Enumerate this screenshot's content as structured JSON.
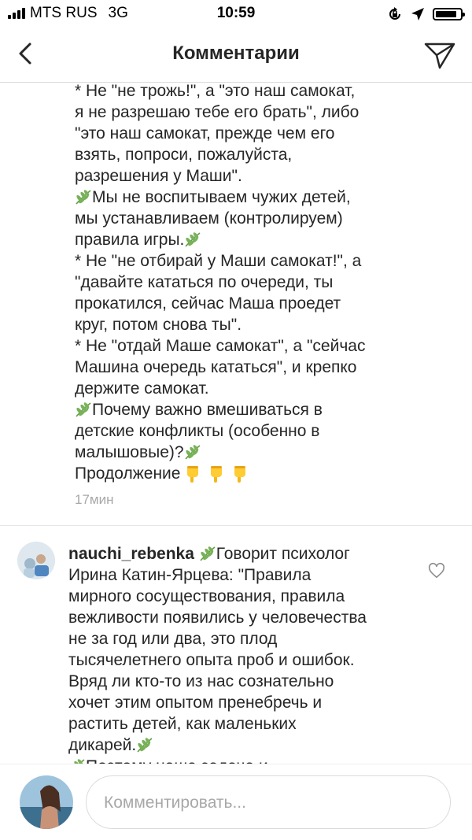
{
  "status_bar": {
    "carrier": "MTS RUS",
    "network": "3G",
    "time": "10:59",
    "icons": [
      "signal-bars-icon",
      "lock-rotation-icon",
      "location-arrow-icon",
      "battery-icon"
    ]
  },
  "header": {
    "title": "Комментарии",
    "back_icon": "chevron-left-icon",
    "send_icon": "paper-plane-icon"
  },
  "first_comment": {
    "lines": [
      "* Не \"не трожь!\", а \"это наш самокат,\nя не разрешаю тебе его брать\", либо\n\"это наш самокат, прежде чем его\nвзять, попроси, пожалуйста,\nразрешения у Маши\".",
      "Мы не воспитываем чужих детей,\nмы устанавливаем (контролируем)\nправила игры.",
      "* Не \"не отбирай у Маши самокат!\", а\n\"давайте кататься по очереди, ты\nпрокатился, сейчас Маша проедет\nкруг, потом снова ты\".",
      "* Не \"отдай Маше самокат\", а \"сейчас\nМашина очередь кататься\", и крепко\nдержите самокат.",
      "Почему важно вмешиваться в\nдетские конфликты (особенно в\nмалышовые)?",
      "Продолжение"
    ],
    "time": "17мин"
  },
  "second_comment": {
    "username": "nauchi_rebenka",
    "text": "Говорит психолог\nИрина Катин-Ярцева: \"Правила\nмирного сосуществования, правила\nвежливости появились у человечества\nне за год или два, это плод\nтысячелетнего опыта проб и ошибок.\nВряд ли кто-то из нас сознательно\nхочет этим опытом пренебречь и\nрастить детей, как маленьких\nдикарей.",
    "cut_line": "Поэтому наша задача и",
    "like_icon": "heart-outline-icon",
    "emoji_icon": "herb-leaf-icon"
  },
  "composer": {
    "placeholder": "Комментировать..."
  },
  "colors": {
    "text": "#262626",
    "muted": "#a8a8a8",
    "divider": "#dbdbdb",
    "leaf": "#78b159"
  }
}
